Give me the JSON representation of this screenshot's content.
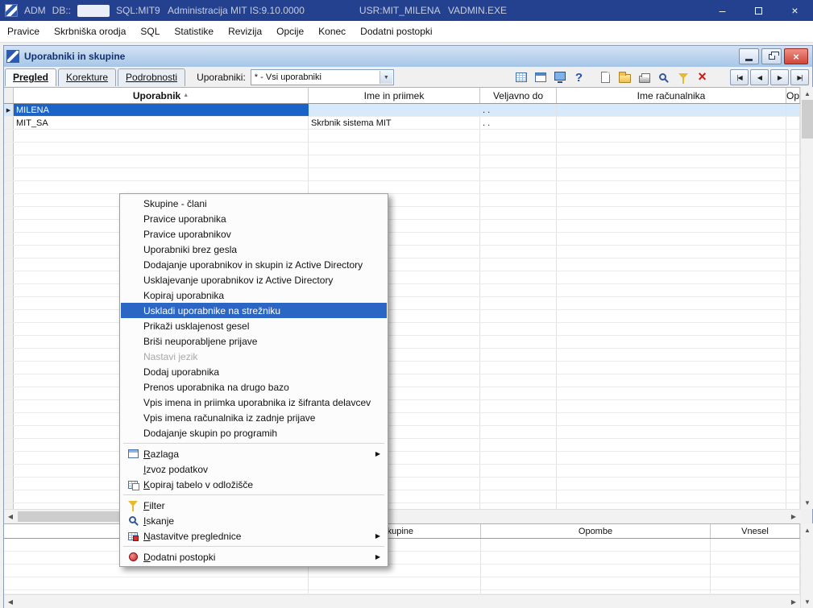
{
  "titlebar": {
    "app_name": "ADM",
    "db_label": "DB::",
    "session_info": "SQL:MIT9   Administracija MIT IS:9.10.0000",
    "user_info": "USR:MIT_MILENA   VADMIN.EXE"
  },
  "menubar": {
    "items": [
      "Pravice",
      "Skrbniška orodja",
      "SQL",
      "Statistike",
      "Revizija",
      "Opcije",
      "Konec",
      "Dodatni postopki"
    ]
  },
  "window": {
    "title": "Uporabniki in skupine",
    "tabs": [
      {
        "label": "Pregled",
        "active": true
      },
      {
        "label": "Korekture",
        "active": false
      },
      {
        "label": "Podrobnosti",
        "active": false
      }
    ],
    "users_filter": {
      "label": "Uporabniki:",
      "value": "* - Vsi uporabniki"
    },
    "toolbar_flat_icons": [
      {
        "name": "grid-icon",
        "cls": "i-grid"
      },
      {
        "name": "form-icon",
        "cls": "i-form"
      },
      {
        "name": "monitor-icon",
        "cls": "i-mon"
      },
      {
        "name": "help-icon",
        "cls": "i-help"
      }
    ],
    "toolbar_action_icons": [
      {
        "name": "new-document-icon",
        "cls": "i-doc"
      },
      {
        "name": "open-folder-icon",
        "cls": "i-folder"
      },
      {
        "name": "print-icon",
        "cls": "i-print"
      },
      {
        "name": "search-icon",
        "cls": "i-mag"
      },
      {
        "name": "filter-icon",
        "cls": "i-funnel"
      },
      {
        "name": "delete-icon",
        "cls": "i-redx"
      }
    ],
    "nav_buttons": [
      {
        "name": "first-record-button",
        "glyph": "|◀"
      },
      {
        "name": "prev-record-button",
        "glyph": "◀"
      },
      {
        "name": "next-record-button",
        "glyph": "▶"
      },
      {
        "name": "last-record-button",
        "glyph": "▶|"
      }
    ]
  },
  "users_grid": {
    "columns": [
      {
        "label": "Uporabnik",
        "sorted": true,
        "bold": true
      },
      {
        "label": "Ime in priimek"
      },
      {
        "label": "Veljavno do"
      },
      {
        "label": "Ime računalnika"
      },
      {
        "label": "Op"
      }
    ],
    "rows": [
      {
        "uporabnik": "MILENA",
        "ime_in_priimek": "",
        "veljavno_do": ". .",
        "ime_racunalnika": "",
        "op": "",
        "selected": true
      },
      {
        "uporabnik": "MIT_SA",
        "ime_in_priimek": "Skrbnik sistema MIT",
        "veljavno_do": ". .",
        "ime_racunalnika": "",
        "op": "",
        "selected": false
      }
    ]
  },
  "groups_grid": {
    "columns": [
      {
        "label": ""
      },
      {
        "label": "e skupine"
      },
      {
        "label": "Opombe"
      },
      {
        "label": "Vnesel"
      }
    ]
  },
  "context_menu": {
    "items": [
      {
        "label": "Skupine - člani"
      },
      {
        "label": "Pravice uporabnika"
      },
      {
        "label": "Pravice uporabnikov"
      },
      {
        "label": "Uporabniki brez gesla"
      },
      {
        "label": "Dodajanje uporabnikov in skupin iz Active Directory"
      },
      {
        "label": "Usklajevanje uporabnikov iz Active Directory"
      },
      {
        "label": "Kopiraj uporabnika"
      },
      {
        "label": "Uskladi uporabnike na strežniku",
        "highlighted": true
      },
      {
        "label": "Prikaži usklajenost gesel"
      },
      {
        "label": "Briši neuporabljene prijave"
      },
      {
        "label": "Nastavi jezik",
        "disabled": true
      },
      {
        "label": "Dodaj uporabnika"
      },
      {
        "label": "Prenos uporabnika na drugo bazo"
      },
      {
        "label": "Vpis imena in priimka uporabnika iz šifranta delavcev"
      },
      {
        "label": "Vpis imena računalnika iz zadnje prijave"
      },
      {
        "label": "Dodajanje skupin po programih"
      },
      {
        "separator": true
      },
      {
        "label": "Razlaga",
        "icon": "explain-window-icon",
        "icls": "m-window",
        "submenu": true,
        "mnemonic": 0
      },
      {
        "label": "Izvoz podatkov",
        "mnemonic": 0
      },
      {
        "label": "Kopiraj tabelo v odložišče",
        "icon": "copy-table-icon",
        "icls": "m-copytbl",
        "mnemonic": 0
      },
      {
        "separator": true
      },
      {
        "label": "Filter",
        "icon": "filter-icon",
        "icls": "i-funnel",
        "mnemonic": 0
      },
      {
        "label": "Iskanje",
        "icon": "search-icon",
        "icls": "i-mag",
        "mnemonic": 0
      },
      {
        "label": "Nastavitve preglednice",
        "icon": "table-settings-icon",
        "icls": "m-tblset",
        "submenu": true,
        "mnemonic": 0
      },
      {
        "separator": true
      },
      {
        "label": "Dodatni postopki",
        "icon": "procedures-icon",
        "icls": "i-seal",
        "submenu": true,
        "mnemonic": 0
      }
    ]
  }
}
